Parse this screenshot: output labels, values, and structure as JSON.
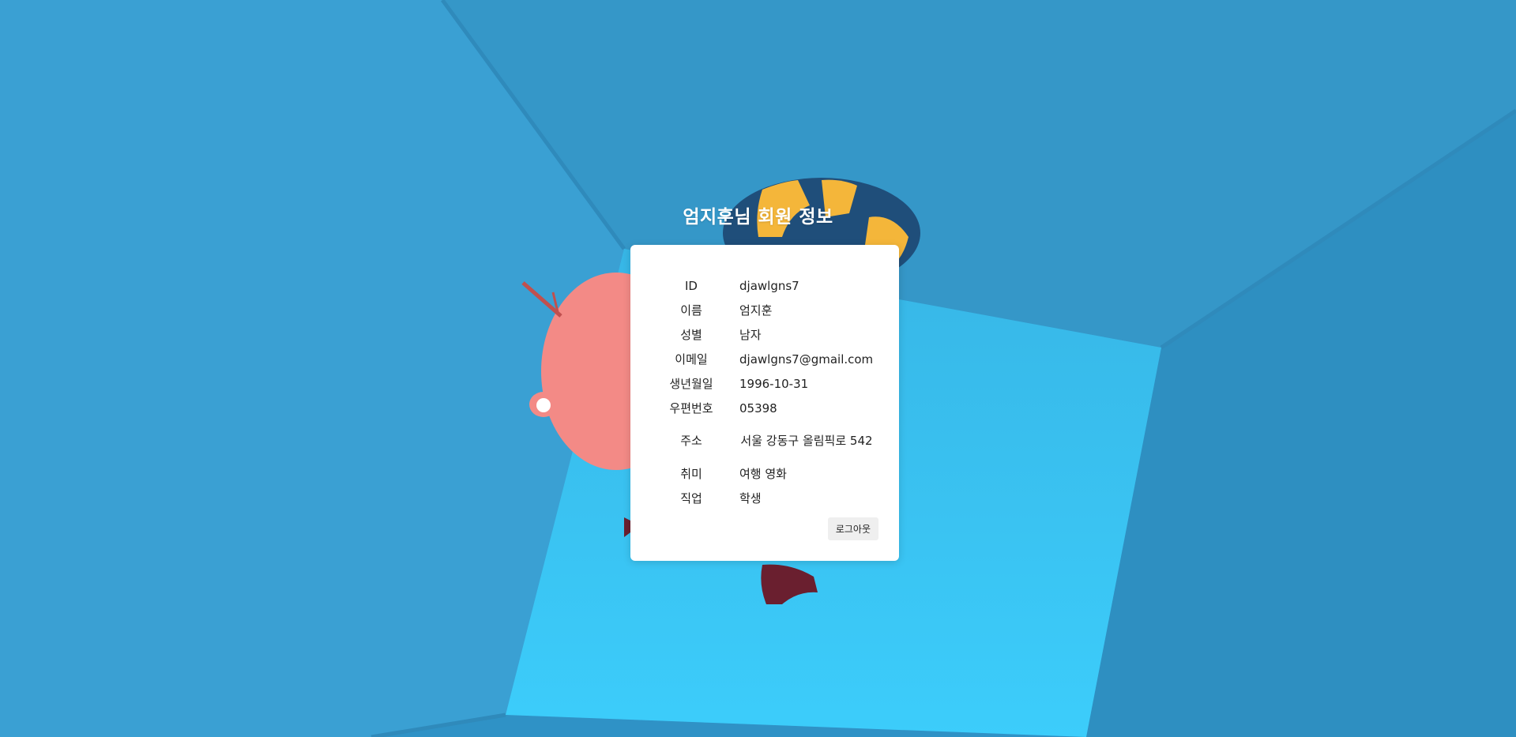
{
  "page": {
    "title": "엄지훈님 회원 정보"
  },
  "member": {
    "rows": [
      {
        "label": "ID",
        "value": "djawlgns7"
      },
      {
        "label": "이름",
        "value": "엄지훈"
      },
      {
        "label": "성별",
        "value": "남자"
      },
      {
        "label": "이메일",
        "value": "djawlgns7@gmail.com"
      },
      {
        "label": "생년월일",
        "value": "1996-10-31"
      },
      {
        "label": "우편번호",
        "value": "05398"
      },
      {
        "label": "주소",
        "value": "서울 강동구 올림픽로 542"
      },
      {
        "label": "취미",
        "value": "여행 영화"
      },
      {
        "label": "직업",
        "value": "학생"
      }
    ]
  },
  "actions": {
    "logout_label": "로그아웃"
  },
  "colors": {
    "background": "#3399cc",
    "floor": "#3bc8f5",
    "card": "#ffffff",
    "title": "#ffffff"
  },
  "background_illustration": "pink-character-with-striped-hat"
}
